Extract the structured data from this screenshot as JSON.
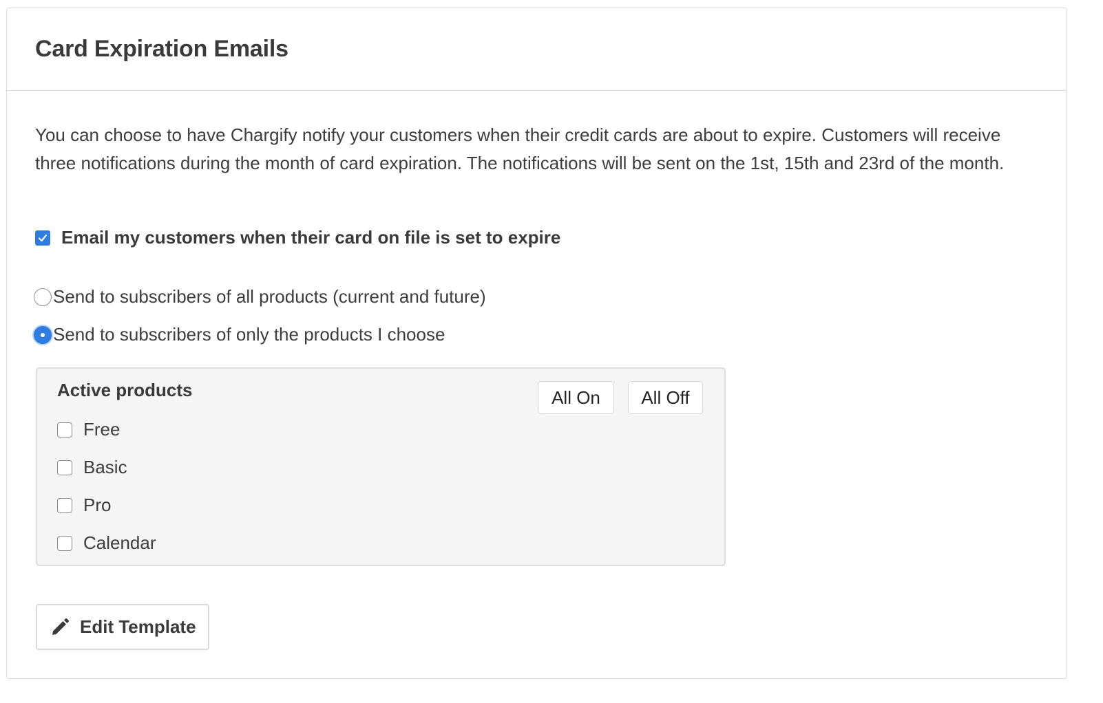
{
  "header": {
    "title": "Card Expiration Emails"
  },
  "description": "You can choose to have Chargify notify your customers when their credit cards are about to expire. Customers will receive three notifications during the month of card expiration. The notifications will be sent on the 1st, 15th and 23rd of the month.",
  "enable_option": {
    "label": "Email my customers when their card on file is set to expire",
    "checked": true
  },
  "recipients": {
    "options": [
      {
        "label": "Send to subscribers of all products (current and future)",
        "selected": false
      },
      {
        "label": "Send to subscribers of only the products I choose",
        "selected": true
      }
    ]
  },
  "products": {
    "title": "Active products",
    "all_on_label": "All On",
    "all_off_label": "All Off",
    "items": [
      {
        "label": "Free",
        "checked": false
      },
      {
        "label": "Basic",
        "checked": false
      },
      {
        "label": "Pro",
        "checked": false
      },
      {
        "label": "Calendar",
        "checked": false
      }
    ]
  },
  "edit_template": {
    "label": "Edit Template",
    "icon": "pencil-icon"
  },
  "colors": {
    "accent": "#2f7de1",
    "text": "#3d3d3d",
    "border": "#dcdcdc",
    "panel_bg": "#f5f5f5"
  }
}
